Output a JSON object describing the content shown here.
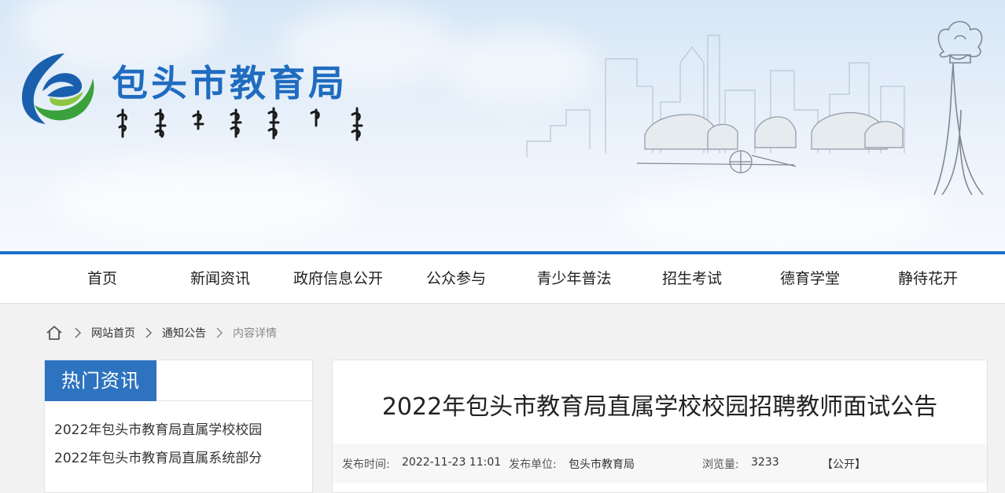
{
  "header": {
    "site_title": "包头市教育局"
  },
  "nav": {
    "items": [
      "首页",
      "新闻资讯",
      "政府信息公开",
      "公众参与",
      "青少年普法",
      "招生考试",
      "德育学堂",
      "静待花开"
    ]
  },
  "breadcrumb": {
    "home_link": "网站首页",
    "section_link": "通知公告",
    "current": "内容详情"
  },
  "sidebar": {
    "title": "热门资讯",
    "items": [
      "2022年包头市教育局直属学校校园",
      "2022年包头市教育局直属系统部分"
    ]
  },
  "article": {
    "title": "2022年包头市教育局直属学校校园招聘教师面试公告",
    "meta": {
      "publish_time_label": "发布时间:",
      "publish_time": "2022-11-23 11:01",
      "publisher_label": "发布单位:",
      "publisher": "包头市教育局",
      "views_label": "浏览量:",
      "views": "3233",
      "visibility": "【公开】"
    }
  },
  "colors": {
    "brand_blue": "#1f6cc0",
    "nav_line": "#1a6fc9",
    "sidebar_tab": "#2d73bf",
    "logo_green": "#3aa13b"
  }
}
